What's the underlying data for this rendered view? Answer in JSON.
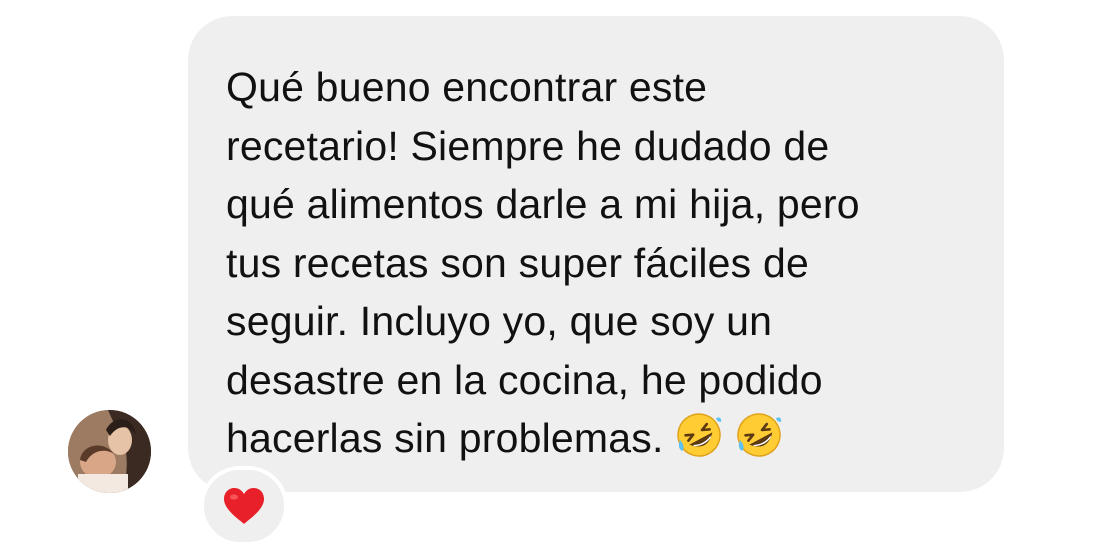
{
  "message": {
    "lines": [
      "Qué bueno encontrar este",
      "recetario! Siempre he dudado de",
      "qué alimentos darle a mi hija, pero",
      "tus recetas son super fáciles de",
      "seguir. Incluyo yo, que soy un",
      "desastre en la cocina, he podido",
      "hacerlas sin problemas."
    ],
    "trailing_emojis": [
      "rolling-on-floor-laughing-emoji",
      "rolling-on-floor-laughing-emoji"
    ],
    "bubble_color": "#efefef",
    "text_color": "#111111"
  },
  "sender": {
    "avatar_icon": "profile-photo-icon"
  },
  "reaction": {
    "icon": "red-heart-icon",
    "color": "#e8202a"
  }
}
